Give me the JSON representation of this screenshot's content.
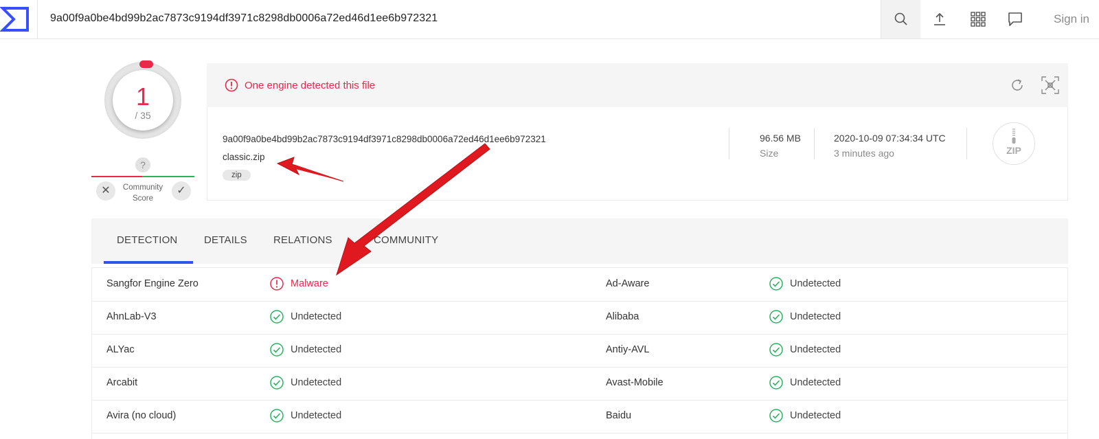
{
  "topbar": {
    "search_value": "9a00f9a0be4bd99b2ac7873c9194df3971c8298db0006a72ed46d1ee6b972321",
    "signin_label": "Sign in"
  },
  "score": {
    "detections": "1",
    "total": "/ 35",
    "community_label_1": "Community",
    "community_label_2": "Score",
    "question_mark": "?"
  },
  "banner": {
    "message": "One engine detected this file"
  },
  "file": {
    "hash": "9a00f9a0be4bd99b2ac7873c9194df3971c8298db0006a72ed46d1ee6b972321",
    "name": "classic.zip",
    "tag": "zip",
    "size_value": "96.56 MB",
    "size_label": "Size",
    "date_value": "2020-10-09 07:34:34 UTC",
    "date_ago": "3 minutes ago",
    "type_icon_text": "ZIP"
  },
  "tabs": [
    "DETECTION",
    "DETAILS",
    "RELATIONS",
    "COMMUNITY"
  ],
  "detections": [
    {
      "left_engine": "Sangfor Engine Zero",
      "left_result": "Malware",
      "left_status": "malware",
      "right_engine": "Ad-Aware",
      "right_result": "Undetected",
      "right_status": "clean"
    },
    {
      "left_engine": "AhnLab-V3",
      "left_result": "Undetected",
      "left_status": "clean",
      "right_engine": "Alibaba",
      "right_result": "Undetected",
      "right_status": "clean"
    },
    {
      "left_engine": "ALYac",
      "left_result": "Undetected",
      "left_status": "clean",
      "right_engine": "Antiy-AVL",
      "right_result": "Undetected",
      "right_status": "clean"
    },
    {
      "left_engine": "Arcabit",
      "left_result": "Undetected",
      "left_status": "clean",
      "right_engine": "Avast-Mobile",
      "right_result": "Undetected",
      "right_status": "clean"
    },
    {
      "left_engine": "Avira (no cloud)",
      "left_result": "Undetected",
      "left_status": "clean",
      "right_engine": "Baidu",
      "right_result": "Undetected",
      "right_status": "clean"
    }
  ],
  "colors": {
    "accent_red": "#e8294a",
    "accent_green": "#29b35f",
    "accent_blue": "#2f54eb",
    "arrow_red": "#e0181f"
  }
}
